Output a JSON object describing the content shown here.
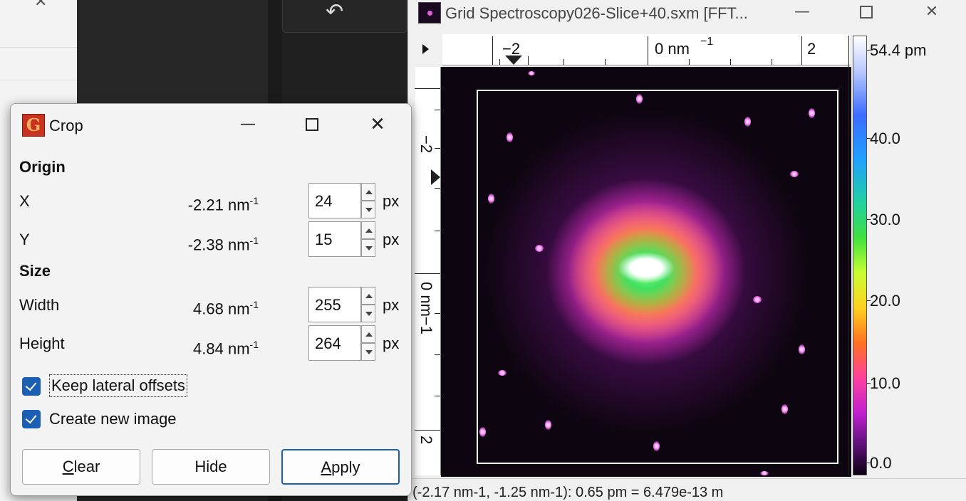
{
  "fft_window": {
    "title": "Grid Spectroscopy026-Slice+40.sxm [FFT...",
    "h_ruler_labels": [
      "−2",
      "0 nm",
      "−1",
      "2"
    ],
    "v_ruler_labels": [
      "−2",
      "0 nm−1",
      "2"
    ],
    "colorbar": {
      "max_label": "54.4 pm",
      "labels": [
        "40.0",
        "30.0",
        "20.0",
        "10.0",
        "0.0"
      ]
    },
    "status_text": "(-2.17 nm-1, -1.25 nm-1): 0.65 pm = 6.479e-13 m"
  },
  "crop_dialog": {
    "title": "Crop",
    "origin_heading": "Origin",
    "size_heading": "Size",
    "fields": [
      {
        "label": "X",
        "value": "-2.21 nm",
        "value_exp": "-1",
        "spin": "24",
        "unit": "px"
      },
      {
        "label": "Y",
        "value": "-2.38 nm",
        "value_exp": "-1",
        "spin": "15",
        "unit": "px"
      },
      {
        "label": "Width",
        "value": "4.68 nm",
        "value_exp": "-1",
        "spin": "255",
        "unit": "px"
      },
      {
        "label": "Height",
        "value": "4.84 nm",
        "value_exp": "-1",
        "spin": "264",
        "unit": "px"
      }
    ],
    "keep_lateral_offsets": {
      "label": "Keep lateral offsets",
      "checked": true
    },
    "create_new_image": {
      "label": "Create new image",
      "checked": true
    },
    "buttons": {
      "clear_first": "C",
      "clear_rest": "lear",
      "hide": "Hide",
      "apply_first": "A",
      "apply_rest": "pply"
    }
  },
  "colors": {
    "accent": "#1a5fb4",
    "dialog_bg": "#f3f3f3",
    "fft_background": "#0d050f"
  }
}
